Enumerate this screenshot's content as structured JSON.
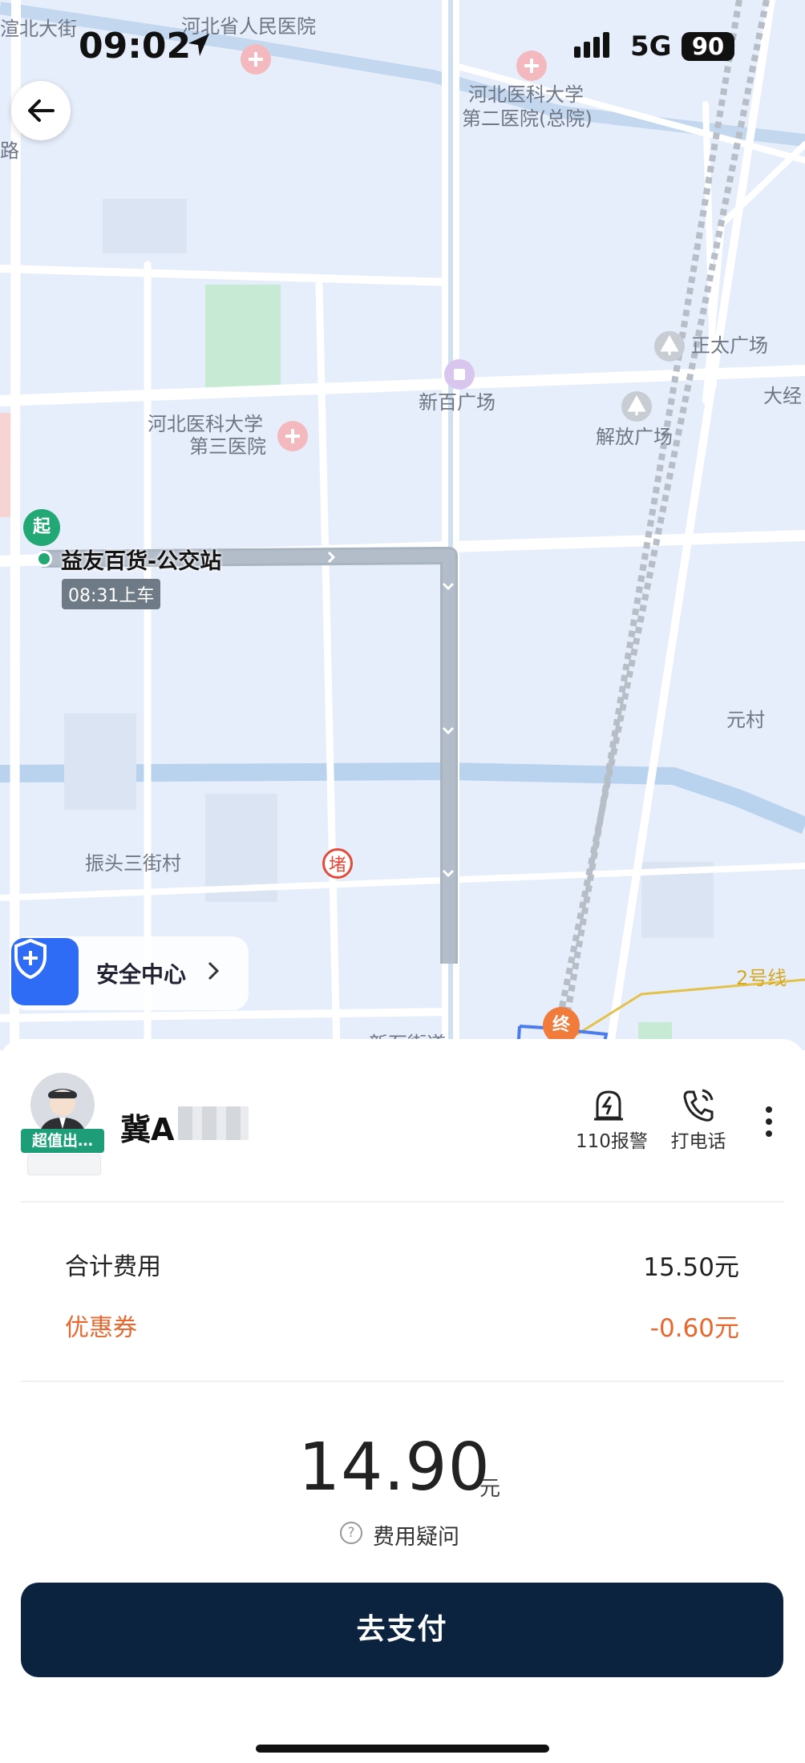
{
  "status_bar": {
    "time": "09:02",
    "network": "5G",
    "battery": "90"
  },
  "map": {
    "labels": {
      "top_street": "渲北大街",
      "hospital_1": "河北省人民医院",
      "hospital_2_line1": "河北医科大学",
      "hospital_2_line2": "第二医院(总院)",
      "road_left": "路",
      "zhengtai": "正太广场",
      "dajing": "大经",
      "xinbai": "新百广场",
      "jiefang": "解放广场",
      "hospital_3_line1": "河北医科大学",
      "hospital_3_line2": "第三医院",
      "yuancun": "元村",
      "zhentou": "振头三街村",
      "line2": "2号线",
      "street_bottom": "新石街道"
    },
    "start_marker": "起",
    "start_name": "益友百货-公交站",
    "start_time": "08:31上车",
    "end_marker": "终",
    "jam_marker": "堵",
    "safety_center": "安全中心"
  },
  "driver": {
    "badge": "超值出…",
    "plate": "冀A"
  },
  "actions": {
    "police": "110报警",
    "call": "打电话"
  },
  "fees": {
    "total_label": "合计费用",
    "total_value": "15.50元",
    "coupon_label": "优惠券",
    "coupon_value": "-0.60元"
  },
  "amount": {
    "value": "14.90",
    "unit": "元"
  },
  "fee_question": "费用疑问",
  "pay_button": "去支付",
  "colors": {
    "primary_button": "#0c2340",
    "coupon": "#e8682f",
    "start": "#21a874",
    "end": "#f07b3a",
    "safety": "#2f6cf6"
  }
}
